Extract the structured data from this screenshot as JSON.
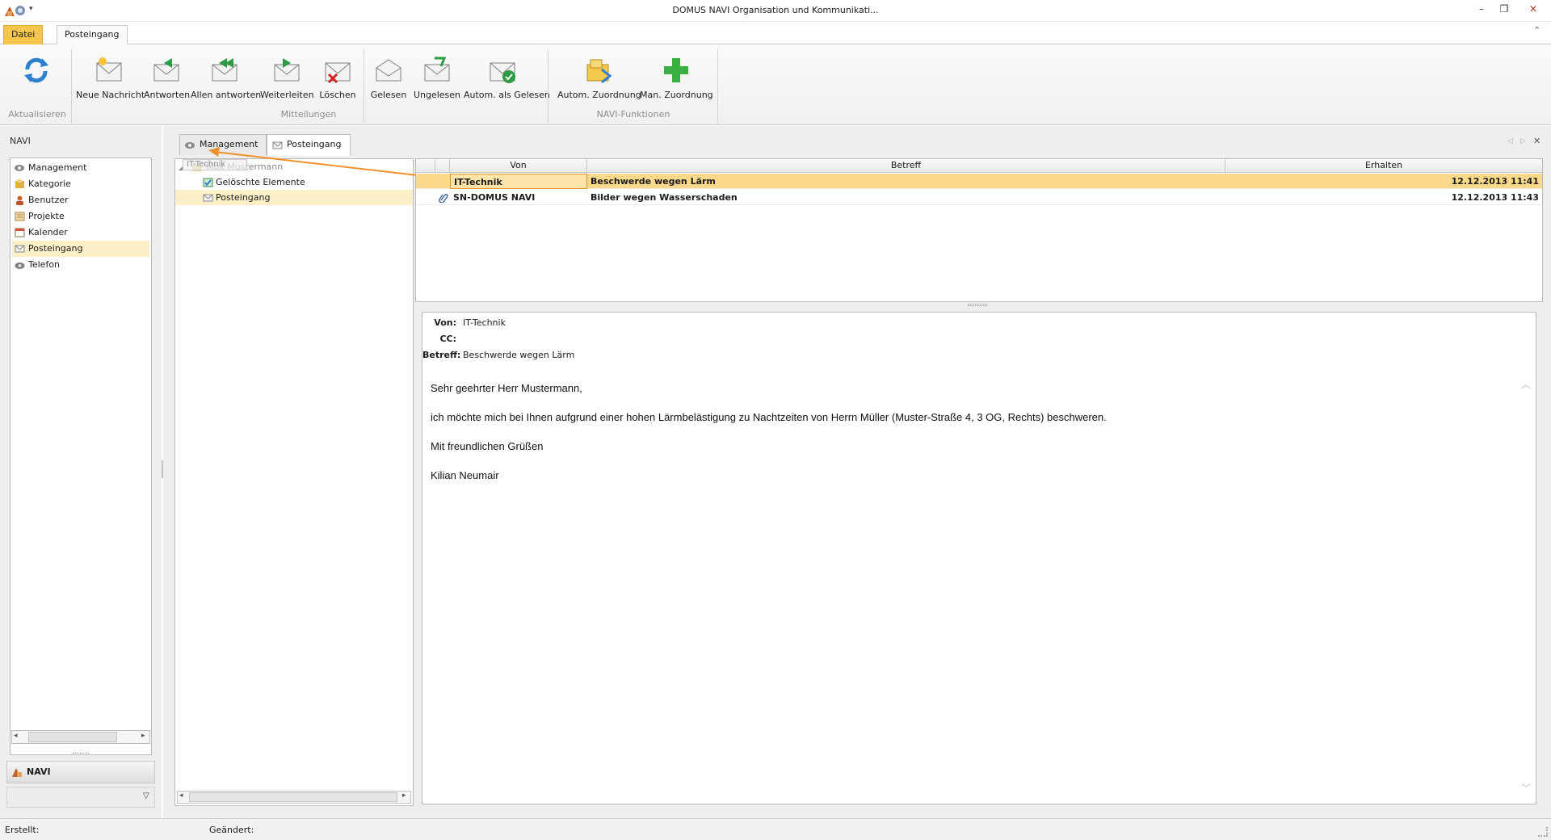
{
  "window": {
    "title": "DOMUS NAVI Organisation und Kommunikati..."
  },
  "ribbon": {
    "tabs": [
      {
        "label": "Datei"
      },
      {
        "label": "Posteingang"
      }
    ],
    "groups": [
      {
        "label": "Aktualisieren",
        "buttons": [
          {
            "label": "",
            "icon": "refresh-icon"
          }
        ]
      },
      {
        "label": "Mitteilungen",
        "buttons": [
          {
            "label": "Neue Nachricht",
            "icon": "new-mail-icon"
          },
          {
            "label": "Antworten",
            "icon": "reply-icon"
          },
          {
            "label": "Allen antworten",
            "icon": "reply-all-icon"
          },
          {
            "label": "Weiterleiten",
            "icon": "forward-icon"
          },
          {
            "label": "Löschen",
            "icon": "delete-mail-icon"
          },
          {
            "label": "Gelesen",
            "icon": "read-mail-icon"
          },
          {
            "label": "Ungelesen",
            "icon": "unread-mail-icon"
          },
          {
            "label": "Autom. als Gelesen",
            "icon": "auto-read-icon"
          }
        ]
      },
      {
        "label": "NAVI-Funktionen",
        "buttons": [
          {
            "label": "Autom. Zuordnung",
            "icon": "auto-assign-icon"
          },
          {
            "label": "Man. Zuordnung",
            "icon": "manual-assign-icon"
          }
        ]
      }
    ]
  },
  "nav": {
    "header": "NAVI",
    "items": [
      {
        "label": "Management",
        "icon": "management-icon"
      },
      {
        "label": "Kategorie",
        "icon": "category-icon"
      },
      {
        "label": "Benutzer",
        "icon": "user-icon"
      },
      {
        "label": "Projekte",
        "icon": "project-icon"
      },
      {
        "label": "Kalender",
        "icon": "calendar-icon"
      },
      {
        "label": "Posteingang",
        "icon": "inbox-icon",
        "selected": true
      },
      {
        "label": "Telefon",
        "icon": "phone-icon"
      }
    ],
    "footer": "NAVI"
  },
  "content": {
    "tabs": [
      {
        "label": "Management"
      },
      {
        "label": "Posteingang",
        "active": true
      }
    ],
    "drag_label": "IT-Technik",
    "tree": {
      "root": "Max Mustermann",
      "children": [
        "Gelöschte Elemente",
        "Posteingang"
      ]
    },
    "messages": {
      "columns": [
        "Von",
        "Betreff",
        "Erhalten"
      ],
      "rows": [
        {
          "from": "IT-Technik",
          "subject": "Beschwerde wegen Lärm",
          "received": "12.12.2013 11:41",
          "attachment": false,
          "selected": true
        },
        {
          "from": "SN-DOMUS NAVI",
          "subject": "Bilder wegen Wasserschaden",
          "received": "12.12.2013 11:43",
          "attachment": true,
          "selected": false
        }
      ]
    },
    "reader": {
      "from_label": "Von:",
      "from": "IT-Technik",
      "cc_label": "CC:",
      "cc": "",
      "subject_label": "Betreff:",
      "subject": "Beschwerde wegen Lärm",
      "body": [
        "Sehr geehrter Herr Mustermann,",
        "ich möchte mich bei Ihnen aufgrund einer hohen Lärmbelästigung zu Nachtzeiten von Herrn Müller (Muster-Straße 4, 3 OG, Rechts) beschweren.",
        "Mit freundlichen Grüßen",
        "Kilian Neumair"
      ]
    }
  },
  "status": {
    "created_label": "Erstellt:",
    "changed_label": "Geändert:"
  },
  "colors": {
    "accent": "#f6c64c",
    "selection": "#fbd98a",
    "nav_selection": "#fdf0c8"
  }
}
